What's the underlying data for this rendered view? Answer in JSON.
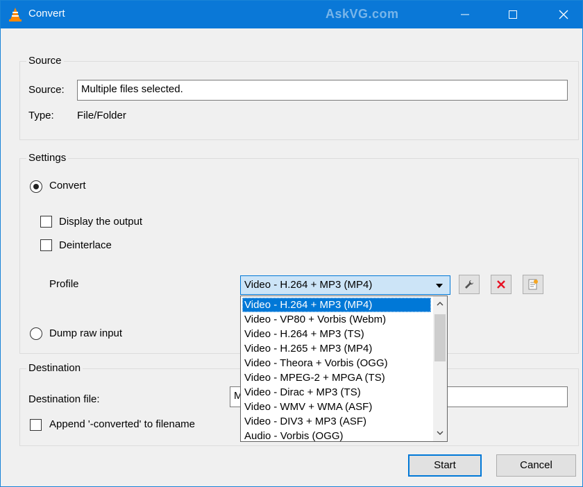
{
  "window": {
    "title": "Convert",
    "watermark": "AskVG.com",
    "controls": {
      "minimize_icon": "minimize-icon",
      "maximize_icon": "maximize-icon",
      "close_icon": "close-icon"
    }
  },
  "source": {
    "group_label": "Source",
    "source_label": "Source:",
    "source_value": "Multiple files selected.",
    "type_label": "Type:",
    "type_value": "File/Folder"
  },
  "settings": {
    "group_label": "Settings",
    "convert_label": "Convert",
    "display_output_label": "Display the output",
    "deinterlace_label": "Deinterlace",
    "profile_label": "Profile",
    "profile_selected": "Video - H.264 + MP3 (MP4)",
    "profile_options": [
      "Video - H.264 + MP3 (MP4)",
      "Video - VP80 + Vorbis (Webm)",
      "Video - H.264 + MP3 (TS)",
      "Video - H.265 + MP3 (MP4)",
      "Video - Theora + Vorbis (OGG)",
      "Video - MPEG-2 + MPGA (TS)",
      "Video - Dirac + MP3 (TS)",
      "Video - WMV + WMA (ASF)",
      "Video - DIV3 + MP3 (ASF)",
      "Audio - Vorbis (OGG)"
    ],
    "dump_raw_label": "Dump raw input",
    "convert_checked": true,
    "display_output_checked": false,
    "deinterlace_checked": false
  },
  "destination": {
    "group_label": "Destination",
    "file_label": "Destination file:",
    "file_value_visible": "M",
    "append_label": "Append '-converted' to filename",
    "append_checked": false
  },
  "buttons": {
    "start": "Start",
    "cancel": "Cancel"
  },
  "colors": {
    "titlebar": "#0a78d7",
    "selection": "#0078d7",
    "delete_icon": "#e81123"
  }
}
